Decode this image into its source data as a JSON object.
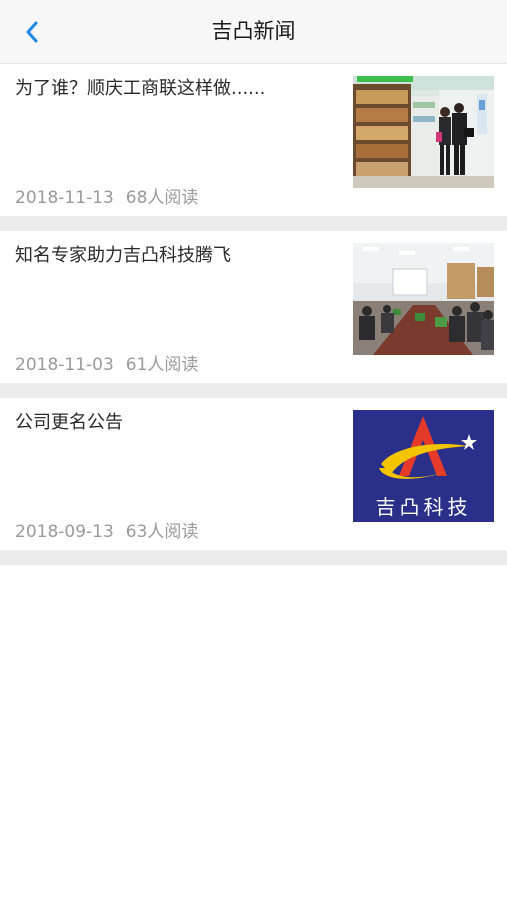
{
  "header": {
    "title": "吉凸新闻",
    "back_icon": "chevron-left-icon",
    "accent_color": "#1e88e5"
  },
  "news": [
    {
      "title": "为了谁？顺庆工商联这样做......",
      "date": "2018-11-13",
      "reads": "68人阅读",
      "thumbnail": "bookstore-visit-photo"
    },
    {
      "title": "知名专家助力吉凸科技腾飞",
      "date": "2018-11-03",
      "reads": "61人阅读",
      "thumbnail": "conference-meeting-photo"
    },
    {
      "title": "公司更名公告",
      "date": "2018-09-13",
      "reads": "63人阅读",
      "thumbnail": "company-logo",
      "logo_text": "吉凸科技"
    }
  ]
}
